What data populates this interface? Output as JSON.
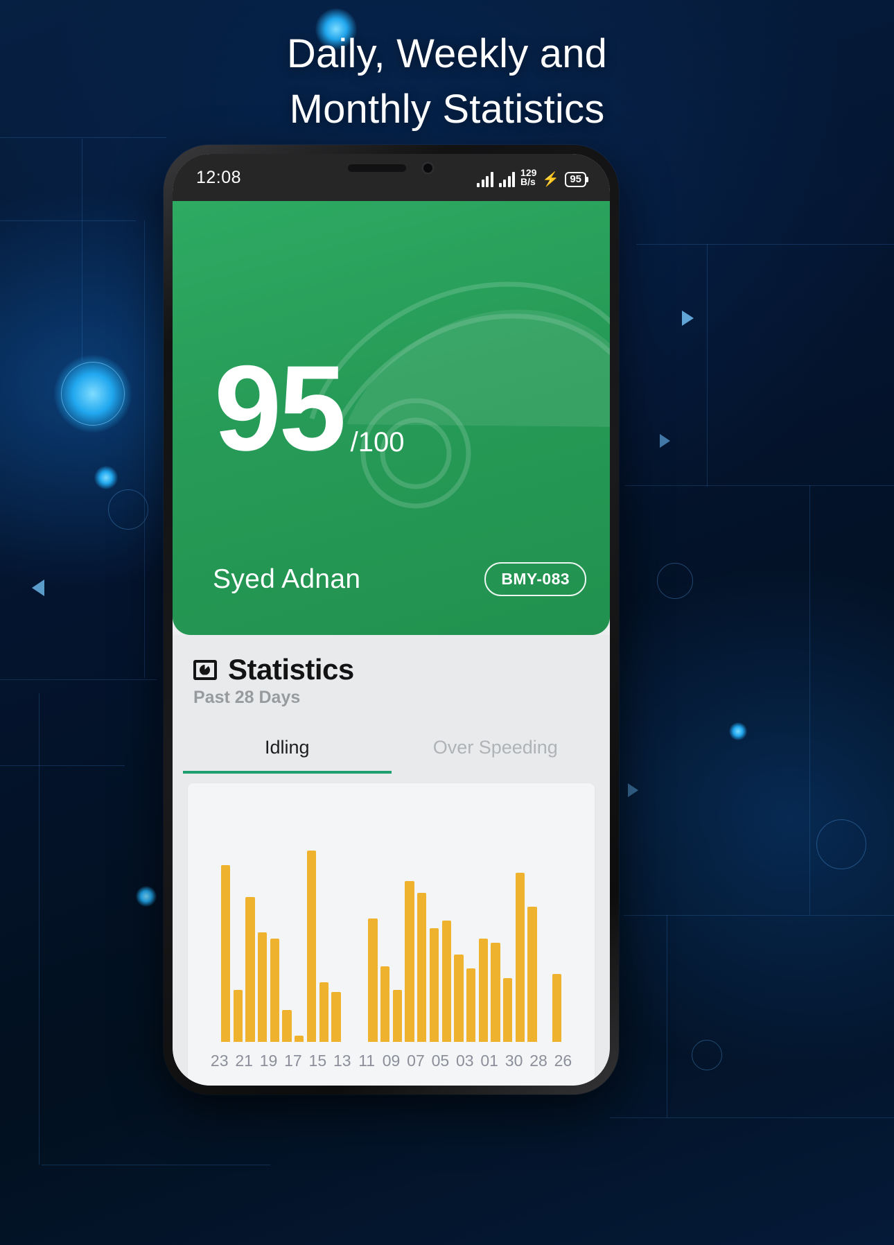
{
  "headline": {
    "line1": "Daily, Weekly and",
    "line2": "Monthly Statistics"
  },
  "status_bar": {
    "time": "12:08",
    "net_speed_value": "129",
    "net_speed_unit": "B/s",
    "charging_icon": "⚡",
    "battery_level": "95"
  },
  "hero": {
    "score": "95",
    "score_max": "/100",
    "driver_name": "Syed Adnan",
    "vehicle_badge": "BMY-083",
    "background_color": "#2aa25d"
  },
  "statistics": {
    "icon": "pie-chart-icon",
    "title": "Statistics",
    "subtitle": "Past 28 Days",
    "tabs": [
      {
        "label": "Idling",
        "active": true
      },
      {
        "label": "Over Speeding",
        "active": false
      }
    ]
  },
  "chart_data": {
    "type": "bar",
    "title": "Statistics",
    "subtitle": "Past 28 Days",
    "series_name": "Idling",
    "bar_color": "#eeb22f",
    "xlabel": "",
    "ylabel": "",
    "grid": false,
    "legend": "none",
    "ylim": [
      0,
      100
    ],
    "categories": [
      "23",
      "",
      "21",
      "",
      "19",
      "",
      "17",
      "",
      "15",
      "",
      "13",
      "",
      "11",
      "",
      "09",
      "",
      "07",
      "",
      "05",
      "",
      "03",
      "",
      "01",
      "",
      "30",
      "",
      "28",
      "",
      "26",
      ""
    ],
    "tick_labels": [
      "23",
      "21",
      "19",
      "17",
      "15",
      "13",
      "11",
      "09",
      "07",
      "05",
      "03",
      "01",
      "30",
      "28",
      "26"
    ],
    "values": [
      0,
      89,
      26,
      73,
      55,
      52,
      16,
      3,
      96,
      30,
      25,
      0,
      0,
      62,
      38,
      26,
      81,
      75,
      57,
      61,
      44,
      37,
      52,
      50,
      32,
      85,
      68,
      0,
      34,
      0
    ]
  }
}
